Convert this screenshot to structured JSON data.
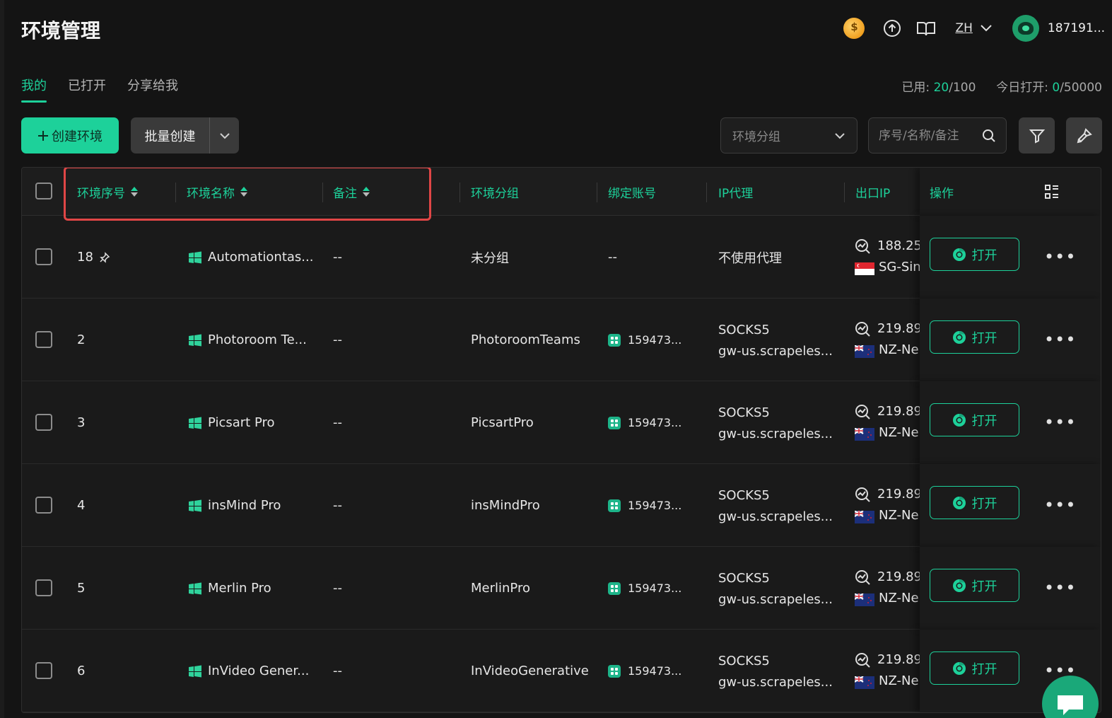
{
  "header": {
    "title": "环境管理",
    "lang": "ZH",
    "username": "187191..."
  },
  "tabs": [
    {
      "label": "我的",
      "active": true
    },
    {
      "label": "已打开",
      "active": false
    },
    {
      "label": "分享给我",
      "active": false
    }
  ],
  "usage": {
    "used_label": "已用:",
    "used": "20",
    "used_total": "/100",
    "today_label": "今日打开:",
    "today": "0",
    "today_total": "/50000"
  },
  "toolbar": {
    "create_label": "创建环境",
    "batch_label": "批量创建",
    "group_placeholder": "环境分组",
    "search_placeholder": "序号/名称/备注"
  },
  "columns": {
    "seq": "环境序号",
    "name": "环境名称",
    "remark": "备注",
    "group": "环境分组",
    "account": "绑定账号",
    "proxy": "IP代理",
    "exit_ip": "出口IP",
    "ops": "操作"
  },
  "rows": [
    {
      "seq": "18",
      "pinned": true,
      "name": "Automationtas...",
      "remark": "--",
      "group": "未分组",
      "account": "--",
      "proxy_type": "不使用代理",
      "proxy_host": "",
      "ip": "188.25",
      "region": "SG-Sin",
      "flag": "SG",
      "open": "打开"
    },
    {
      "seq": "2",
      "pinned": false,
      "name": "Photoroom Te...",
      "remark": "--",
      "group": "PhotoroomTeams",
      "account": "159473...",
      "proxy_type": "SOCKS5",
      "proxy_host": "gw-us.scrapeles...",
      "ip": "219.89.",
      "region": "NZ-Ne",
      "flag": "NZ",
      "open": "打开"
    },
    {
      "seq": "3",
      "pinned": false,
      "name": "Picsart Pro",
      "remark": "--",
      "group": "PicsartPro",
      "account": "159473...",
      "proxy_type": "SOCKS5",
      "proxy_host": "gw-us.scrapeles...",
      "ip": "219.89.",
      "region": "NZ-Ne",
      "flag": "NZ",
      "open": "打开"
    },
    {
      "seq": "4",
      "pinned": false,
      "name": "insMind Pro",
      "remark": "--",
      "group": "insMindPro",
      "account": "159473...",
      "proxy_type": "SOCKS5",
      "proxy_host": "gw-us.scrapeles...",
      "ip": "219.89.",
      "region": "NZ-Ne",
      "flag": "NZ",
      "open": "打开"
    },
    {
      "seq": "5",
      "pinned": false,
      "name": "Merlin Pro",
      "remark": "--",
      "group": "MerlinPro",
      "account": "159473...",
      "proxy_type": "SOCKS5",
      "proxy_host": "gw-us.scrapeles...",
      "ip": "219.89.",
      "region": "NZ-Ne",
      "flag": "NZ",
      "open": "打开"
    },
    {
      "seq": "6",
      "pinned": false,
      "name": "InVideo Gener...",
      "remark": "--",
      "group": "InVideoGenerative",
      "account": "159473...",
      "proxy_type": "SOCKS5",
      "proxy_host": "gw-us.scrapeles...",
      "ip": "219.89.",
      "region": "NZ-Ne",
      "flag": "NZ",
      "open": "打开"
    }
  ],
  "colors": {
    "accent": "#1dd19a",
    "background": "#141414",
    "highlight": "#e04646"
  }
}
